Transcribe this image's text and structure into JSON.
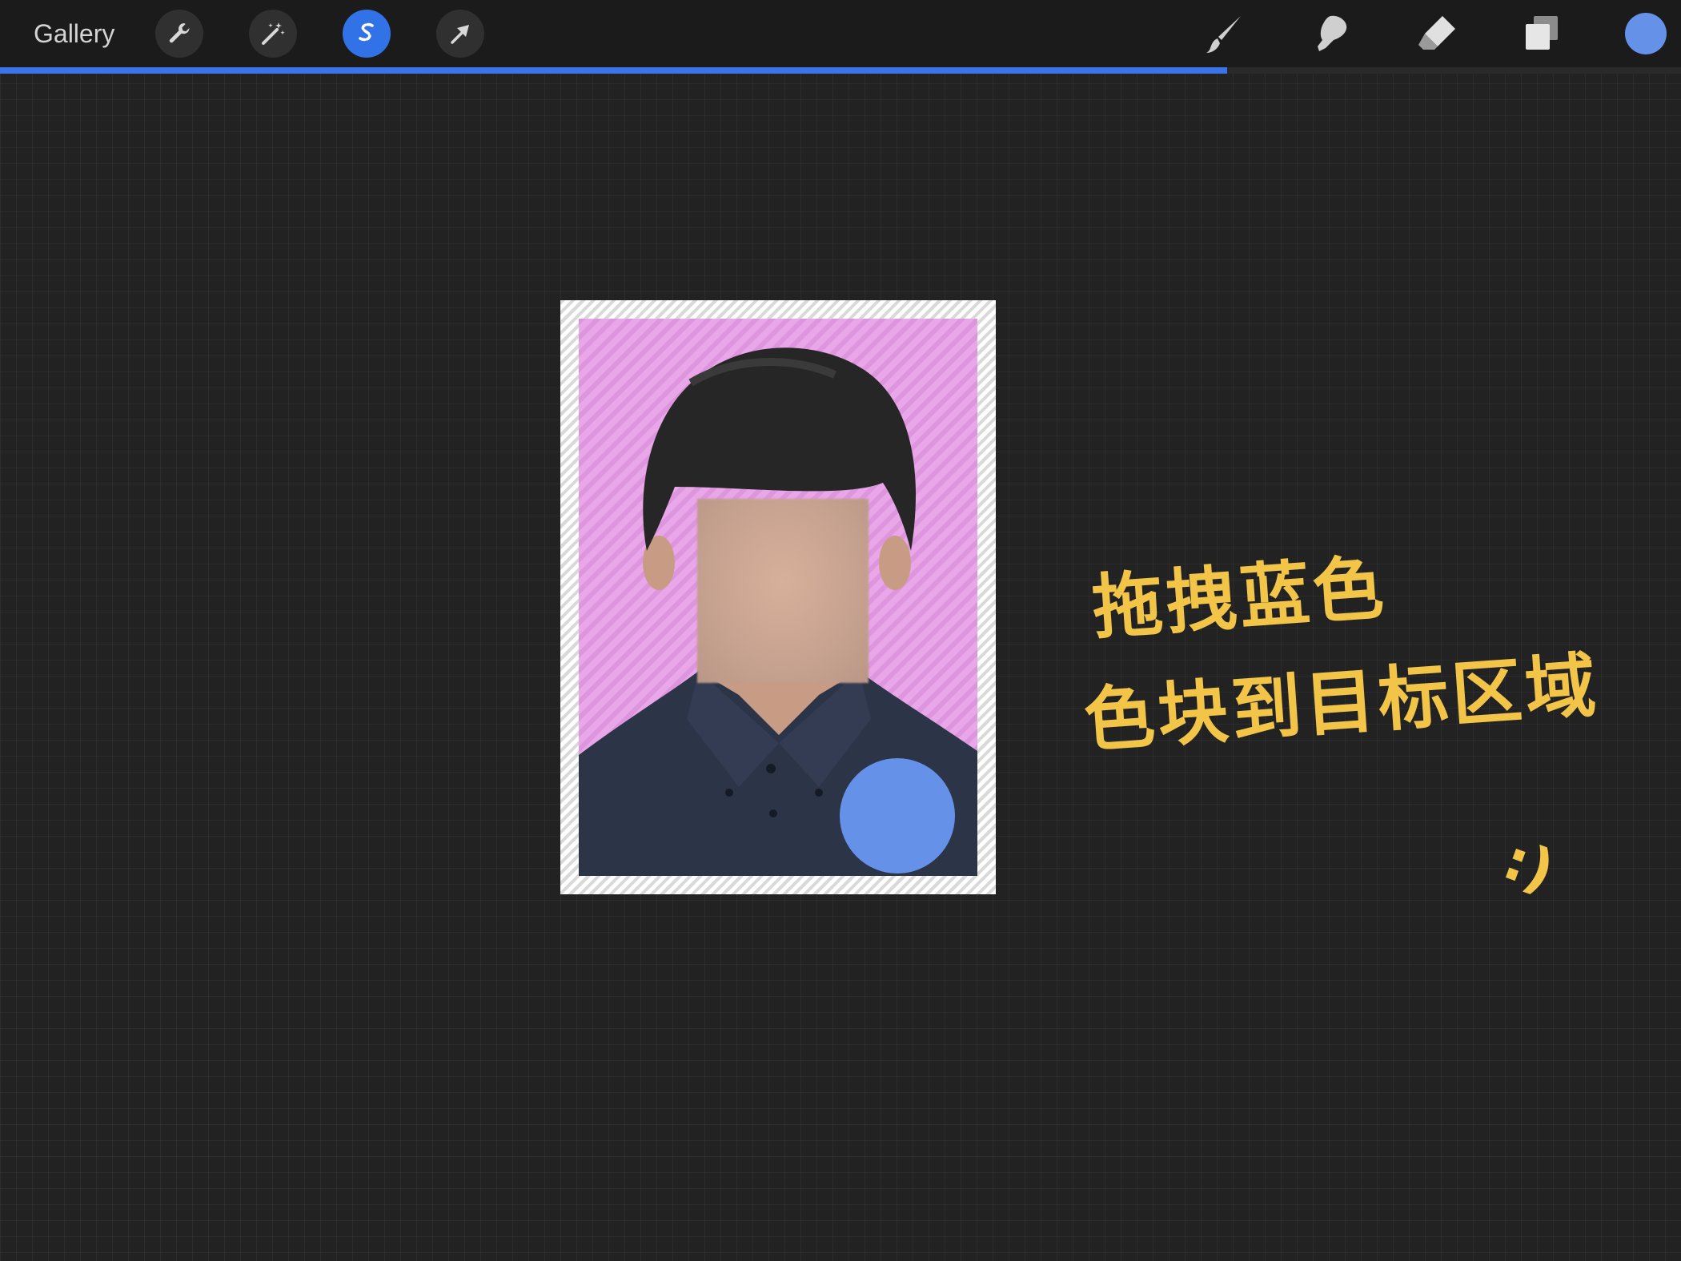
{
  "toolbar": {
    "gallery_label": "Gallery",
    "left_tools": [
      {
        "name": "actions",
        "icon": "wrench-icon"
      },
      {
        "name": "adjustments",
        "icon": "magic-wand-icon"
      },
      {
        "name": "selection",
        "icon": "selection-s-icon",
        "active": true
      },
      {
        "name": "transform",
        "icon": "transform-arrow-icon"
      }
    ],
    "right_tools": [
      {
        "name": "brush",
        "icon": "brush-icon"
      },
      {
        "name": "smudge",
        "icon": "smudge-icon"
      },
      {
        "name": "eraser",
        "icon": "eraser-icon"
      },
      {
        "name": "layers",
        "icon": "layers-icon"
      }
    ],
    "current_color": "#6592e8",
    "progress_fraction": 0.73
  },
  "canvas": {
    "note": {
      "line1": "拖拽蓝色",
      "line2": "色块到目标区域",
      "smile": ":)",
      "color": "#f2c548"
    },
    "photo": {
      "background_color": "#e9a6e8",
      "shirt_color": "#2c3448",
      "dot_color": "#6592e8"
    }
  },
  "colors": {
    "accent": "#3173e6",
    "progress": "#3a74e8",
    "toolbar_bg": "#1b1b1b",
    "canvas_bg": "#222222"
  }
}
